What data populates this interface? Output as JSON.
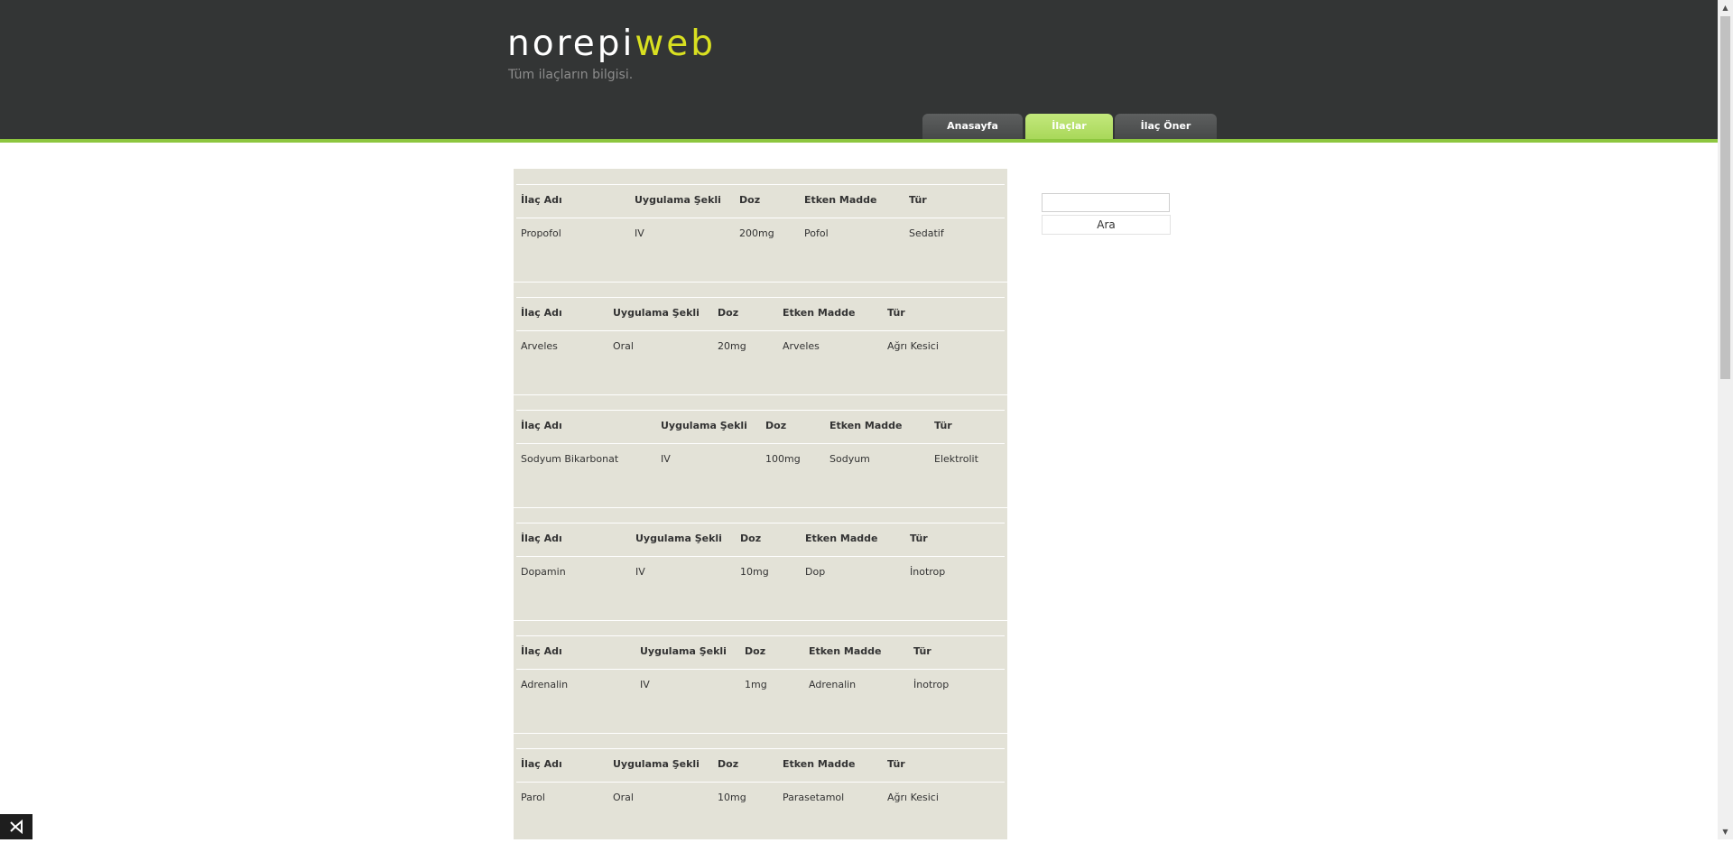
{
  "header": {
    "logo_part1": "norepi",
    "logo_part2": "web",
    "tagline": "Tüm ilaçların bilgisi."
  },
  "nav": {
    "tabs": [
      {
        "label": "Anasayfa",
        "active": false
      },
      {
        "label": "İlaçlar",
        "active": true
      },
      {
        "label": "İlaç Öner",
        "active": false
      }
    ]
  },
  "columns": [
    "İlaç Adı",
    "Uygulama Şekli",
    "Doz",
    "Etken Madde",
    "Tür"
  ],
  "drugs": [
    {
      "name": "Propofol",
      "route": "IV",
      "dose": "200mg",
      "active_ingredient": "Pofol",
      "type": "Sedatif"
    },
    {
      "name": "Arveles",
      "route": "Oral",
      "dose": "20mg",
      "active_ingredient": "Arveles",
      "type": "Ağrı Kesici"
    },
    {
      "name": "Sodyum Bikarbonat",
      "route": "IV",
      "dose": "100mg",
      "active_ingredient": "Sodyum",
      "type": "Elektrolit"
    },
    {
      "name": "Dopamin",
      "route": "IV",
      "dose": "10mg",
      "active_ingredient": "Dop",
      "type": "İnotrop"
    },
    {
      "name": "Adrenalin",
      "route": "IV",
      "dose": "1mg",
      "active_ingredient": "Adrenalin",
      "type": "İnotrop"
    },
    {
      "name": "Parol",
      "route": "Oral",
      "dose": "10mg",
      "active_ingredient": "Parasetamol",
      "type": "Ağrı Kesici"
    }
  ],
  "search": {
    "placeholder": "",
    "button_label": "Ara"
  },
  "scrollbar": {
    "up_icon": "arrow-up-icon",
    "down_icon": "arrow-down-icon"
  },
  "badge": {
    "icon": "visual-studio-icon"
  }
}
